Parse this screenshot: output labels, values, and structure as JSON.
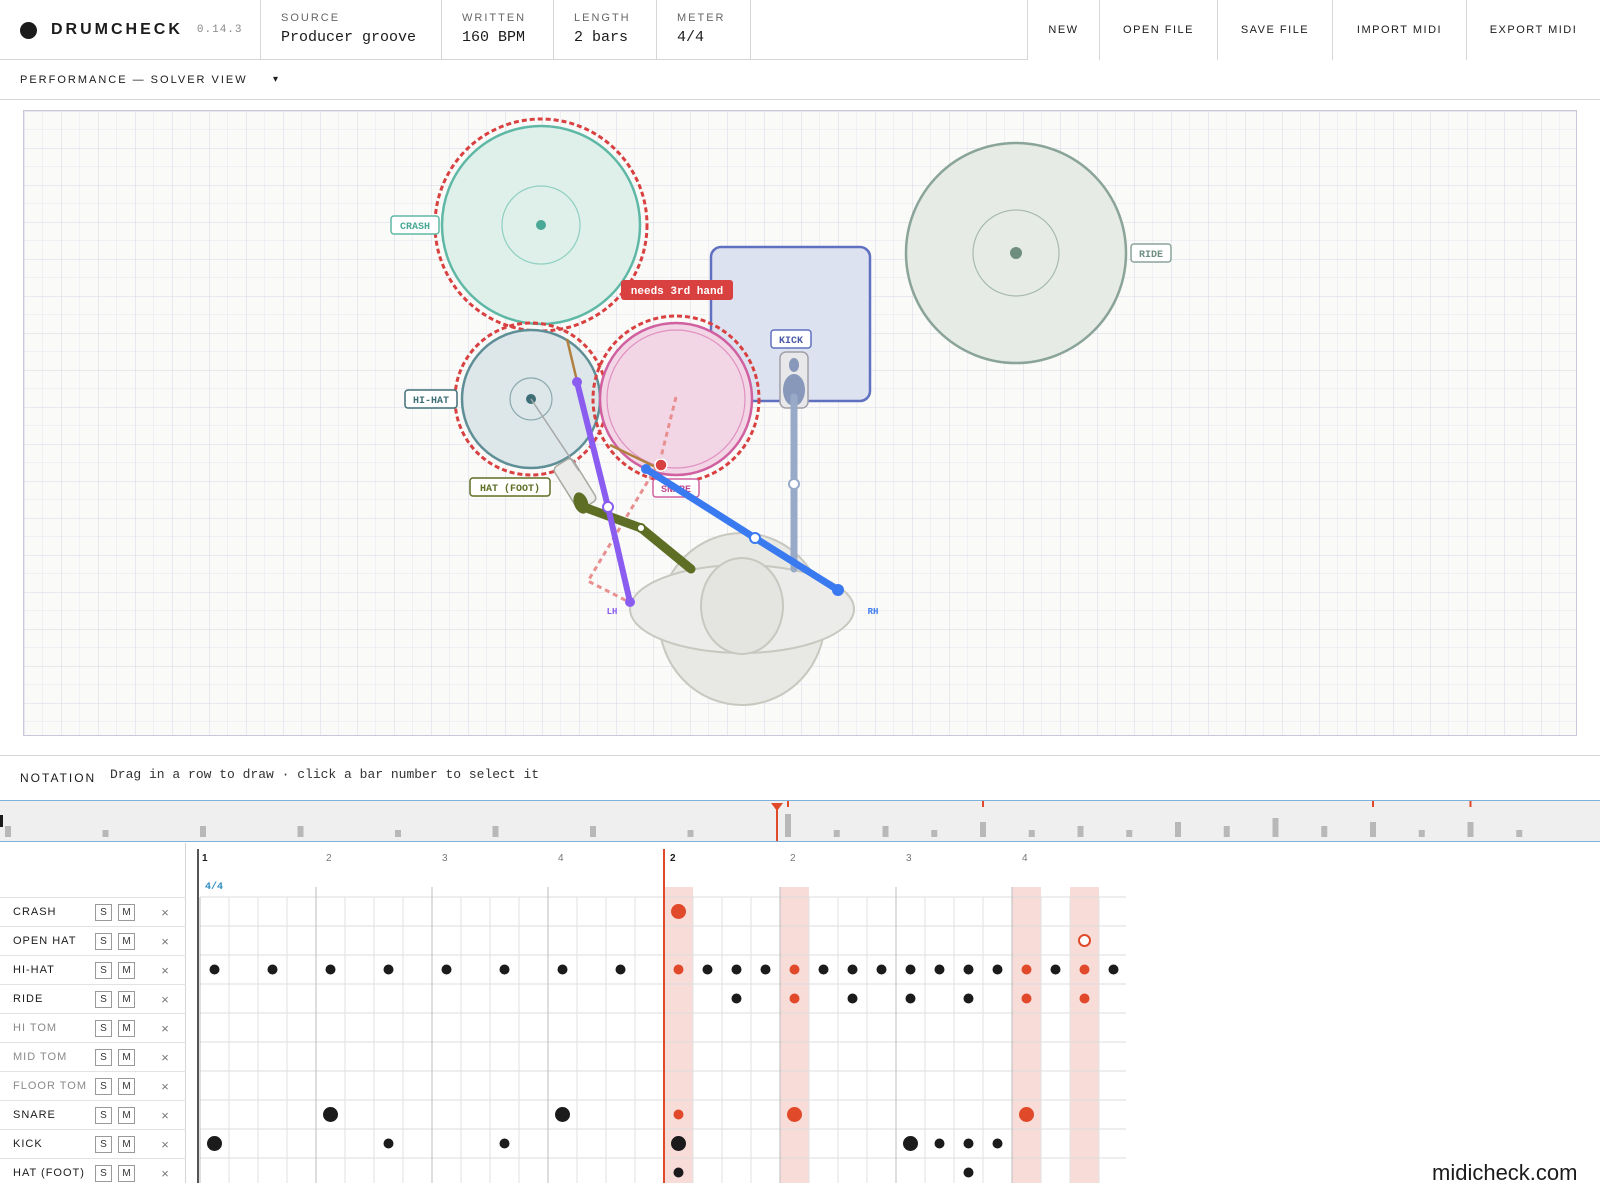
{
  "app": {
    "name": "DRUMCHECK",
    "version": "0.14.3"
  },
  "meta": [
    {
      "key": "source",
      "label": "SOURCE",
      "value": "Producer groove"
    },
    {
      "key": "written",
      "label": "WRITTEN",
      "value": "160 BPM"
    },
    {
      "key": "length",
      "label": "LENGTH",
      "value": "2 bars"
    },
    {
      "key": "meter",
      "label": "METER",
      "value": "4/4"
    }
  ],
  "toolbar": [
    "NEW",
    "OPEN FILE",
    "SAVE FILE",
    "IMPORT MIDI",
    "EXPORT MIDI"
  ],
  "view": {
    "title": "PERFORMANCE — SOLVER VIEW",
    "caret": "▾"
  },
  "solver": {
    "labels": {
      "crash": "CRASH",
      "ride": "RIDE",
      "kick": "KICK",
      "hihat": "HI-HAT",
      "hatfoot": "HAT (FOOT)",
      "snare": "SNARE",
      "lh": "LH",
      "rh": "RH"
    },
    "warning": "needs 3rd hand"
  },
  "notation": {
    "title": "NOTATION",
    "hint": "Drag in a row to draw · click a bar number to select it",
    "meter_mark": "4/4",
    "bar_numbers": [
      "1",
      "2"
    ],
    "beat_numbers": [
      "2",
      "3",
      "4"
    ],
    "tracks": [
      {
        "name": "CRASH",
        "dim": false
      },
      {
        "name": "OPEN HAT",
        "dim": false
      },
      {
        "name": "HI-HAT",
        "dim": false
      },
      {
        "name": "RIDE",
        "dim": false
      },
      {
        "name": "HI TOM",
        "dim": true
      },
      {
        "name": "MID TOM",
        "dim": true
      },
      {
        "name": "FLOOR TOM",
        "dim": true
      },
      {
        "name": "SNARE",
        "dim": false
      },
      {
        "name": "KICK",
        "dim": false
      },
      {
        "name": "HAT (FOOT)",
        "dim": false
      }
    ],
    "solo_label": "S",
    "mute_label": "M",
    "remove_label": "×",
    "highlighted_steps": [
      16,
      20,
      28,
      30
    ],
    "notes": [
      {
        "track": 0,
        "step": 16,
        "size": "L",
        "flag": true
      },
      {
        "track": 1,
        "step": 30,
        "size": "M",
        "flag": true,
        "hollow": true
      },
      {
        "track": 2,
        "step": 0
      },
      {
        "track": 2,
        "step": 2
      },
      {
        "track": 2,
        "step": 4
      },
      {
        "track": 2,
        "step": 6
      },
      {
        "track": 2,
        "step": 8
      },
      {
        "track": 2,
        "step": 10
      },
      {
        "track": 2,
        "step": 12
      },
      {
        "track": 2,
        "step": 14
      },
      {
        "track": 2,
        "step": 16,
        "flag": true
      },
      {
        "track": 2,
        "step": 17
      },
      {
        "track": 2,
        "step": 18
      },
      {
        "track": 2,
        "step": 19
      },
      {
        "track": 2,
        "step": 20,
        "flag": true
      },
      {
        "track": 2,
        "step": 21
      },
      {
        "track": 2,
        "step": 22
      },
      {
        "track": 2,
        "step": 23
      },
      {
        "track": 2,
        "step": 24
      },
      {
        "track": 2,
        "step": 25
      },
      {
        "track": 2,
        "step": 26
      },
      {
        "track": 2,
        "step": 27
      },
      {
        "track": 2,
        "step": 28,
        "flag": true
      },
      {
        "track": 2,
        "step": 29
      },
      {
        "track": 2,
        "step": 30,
        "flag": true
      },
      {
        "track": 2,
        "step": 31
      },
      {
        "track": 3,
        "step": 18
      },
      {
        "track": 3,
        "step": 20,
        "flag": true
      },
      {
        "track": 3,
        "step": 22
      },
      {
        "track": 3,
        "step": 24
      },
      {
        "track": 3,
        "step": 26
      },
      {
        "track": 3,
        "step": 28,
        "flag": true
      },
      {
        "track": 3,
        "step": 30,
        "flag": true
      },
      {
        "track": 7,
        "step": 4,
        "size": "L"
      },
      {
        "track": 7,
        "step": 12,
        "size": "L"
      },
      {
        "track": 7,
        "step": 16,
        "flag": true
      },
      {
        "track": 7,
        "step": 20,
        "size": "L",
        "flag": true
      },
      {
        "track": 7,
        "step": 28,
        "size": "L",
        "flag": true
      },
      {
        "track": 8,
        "step": 0,
        "size": "L"
      },
      {
        "track": 8,
        "step": 6
      },
      {
        "track": 8,
        "step": 10
      },
      {
        "track": 8,
        "step": 16,
        "size": "L"
      },
      {
        "track": 8,
        "step": 24,
        "size": "L"
      },
      {
        "track": 8,
        "step": 25
      },
      {
        "track": 8,
        "step": 26
      },
      {
        "track": 8,
        "step": 27
      },
      {
        "track": 9,
        "step": 16
      },
      {
        "track": 9,
        "step": 26
      }
    ]
  },
  "watermark": "midicheck.com",
  "colors": {
    "accent": "#e04a2a",
    "warning": "#d94040",
    "crash": "#5fb8a6",
    "hihat": "#5e8e96",
    "snare": "#d060a0",
    "kick": "#6070c0",
    "ride": "#8aa49a",
    "left_hand": "#8a5cf0",
    "right_hand": "#3a7af0",
    "foot": "#5e6e24"
  }
}
